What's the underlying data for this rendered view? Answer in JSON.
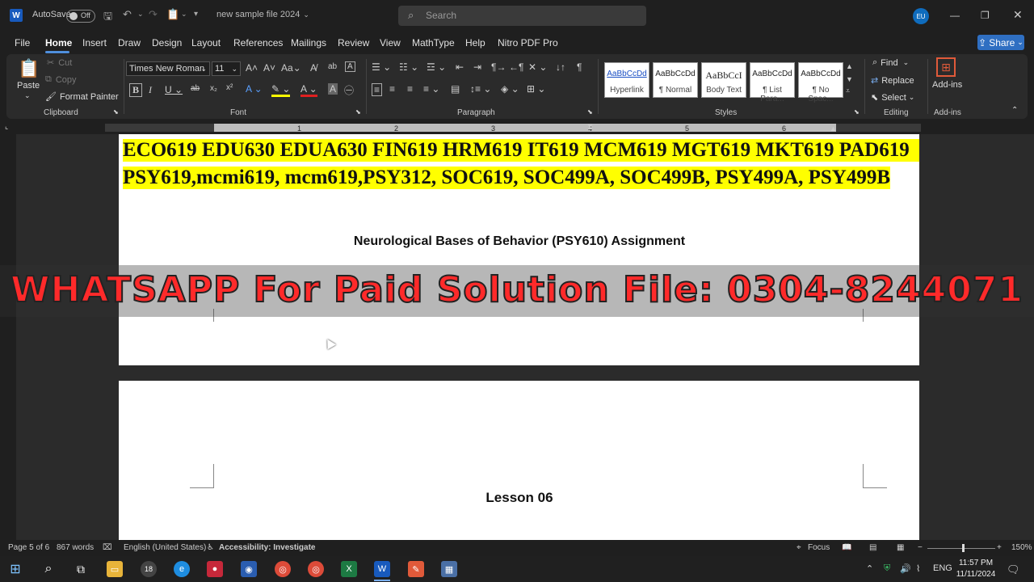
{
  "titlebar": {
    "autosave_label": "AutoSave",
    "autosave_state": "Off",
    "filename": "new sample file 2024",
    "search_placeholder": "Search",
    "avatar_initials": "EU"
  },
  "menu": {
    "items": [
      "File",
      "Home",
      "Insert",
      "Draw",
      "Design",
      "Layout",
      "References",
      "Mailings",
      "Review",
      "View",
      "MathType",
      "Help",
      "Nitro PDF Pro"
    ],
    "active": "Home",
    "share_label": "Share"
  },
  "ribbon": {
    "clipboard": {
      "label": "Clipboard",
      "paste": "Paste",
      "cut": "Cut",
      "copy": "Copy",
      "format_painter": "Format Painter"
    },
    "font": {
      "label": "Font",
      "font_name": "Times New Roman",
      "font_size": "11"
    },
    "paragraph": {
      "label": "Paragraph"
    },
    "styles": {
      "label": "Styles",
      "tiles": [
        {
          "sample": "AaBbCcDd",
          "name": "Hyperlink"
        },
        {
          "sample": "AaBbCcDd",
          "name": "¶ Normal"
        },
        {
          "sample": "AaBbCcI",
          "name": "Body Text"
        },
        {
          "sample": "AaBbCcDd",
          "name": "¶ List Para..."
        },
        {
          "sample": "AaBbCcDd",
          "name": "¶ No Spac..."
        }
      ]
    },
    "editing": {
      "label": "Editing",
      "find": "Find",
      "replace": "Replace",
      "select": "Select"
    },
    "addins": {
      "label": "Add-ins",
      "button": "Add-ins"
    }
  },
  "ruler": {
    "numbers": [
      "1",
      "2",
      "3",
      "4",
      "5",
      "6"
    ]
  },
  "document": {
    "line1": "ECO619 EDU630 EDUA630 FIN619 HRM619 IT619 MCM619 MGT619 MKT619 PAD619",
    "line2": "PSY619,mcmi619, mcm619,PSY312, SOC619, SOC499A, SOC499B, PSY499A, PSY499B",
    "heading": "Neurological Bases of Behavior (PSY610) Assignment",
    "watermark": "WHATSAPP For Paid Solution File: 0304-8244071",
    "lesson": "Lesson 06"
  },
  "statusbar": {
    "page": "Page 5 of 6",
    "words": "867 words",
    "language": "English (United States)",
    "accessibility": "Accessibility: Investigate",
    "focus": "Focus",
    "zoom": "150%"
  },
  "taskbar": {
    "badge": "18",
    "lang": "ENG",
    "time": "11:57 PM",
    "date": "11/11/2024"
  }
}
